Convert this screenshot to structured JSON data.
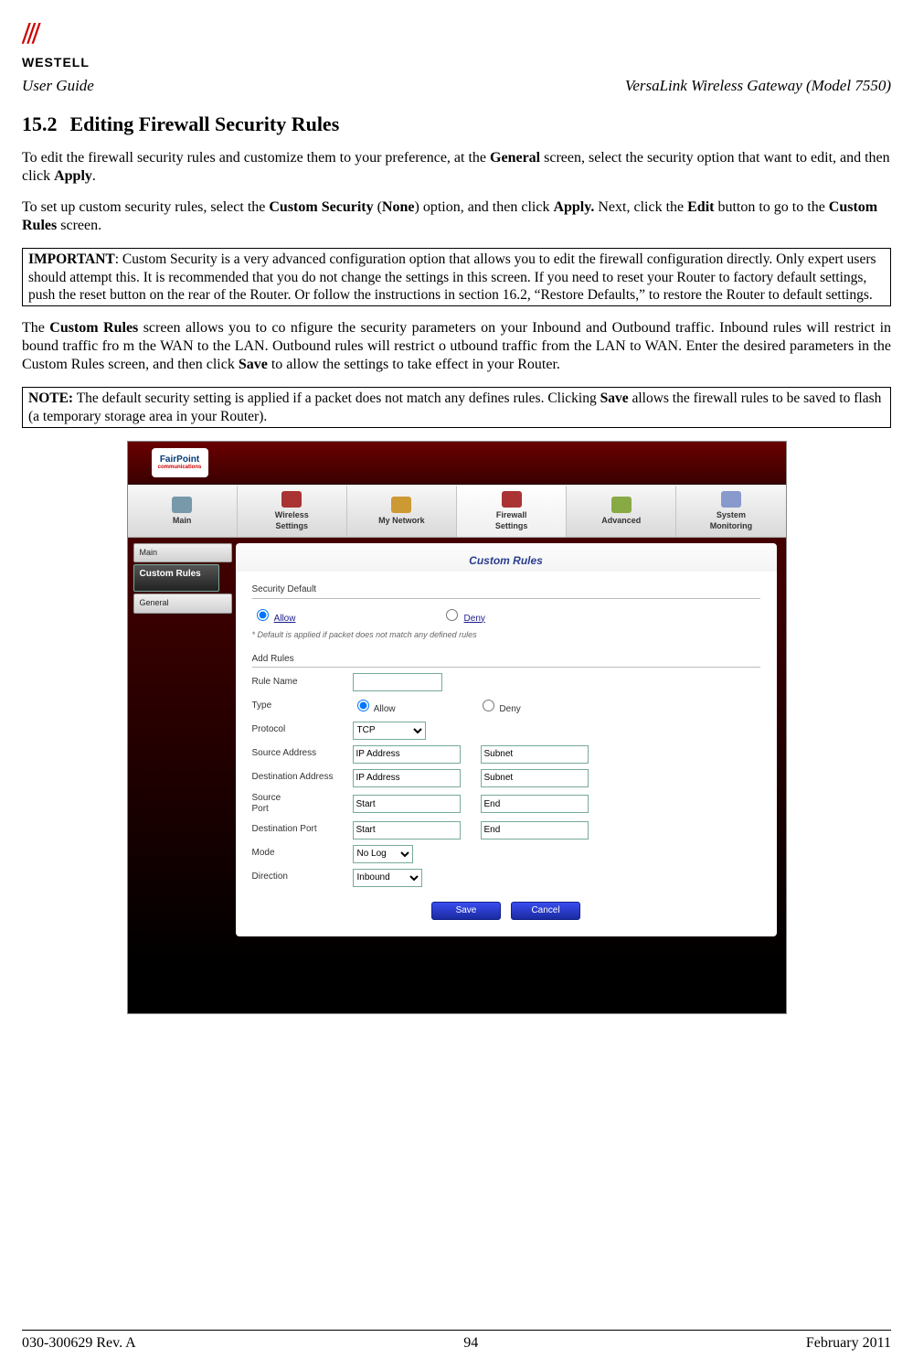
{
  "header": {
    "logo_text": "WESTELL",
    "left": "User Guide",
    "right": "VersaLink Wireless Gateway (Model 7550)"
  },
  "section": {
    "number": "15.2",
    "title": "Editing Firewall Security Rules"
  },
  "para1_a": "To edit the firewall security rules and customize them to your preference, at the ",
  "para1_b": "General",
  "para1_c": " screen, select the security option that want to edit, and then click ",
  "para1_d": "Apply",
  "para1_e": ".",
  "para2_a": "To set up custom security rules, select the ",
  "para2_b": "Custom Security",
  "para2_c": " (",
  "para2_d": "None",
  "para2_e": ") option, and then click ",
  "para2_f": "Apply.",
  "para2_g": " Next, click the ",
  "para2_h": "Edit",
  "para2_i": " button to go to the ",
  "para2_j": "Custom Rules",
  "para2_k": " screen.",
  "box1_a": "IMPORTANT",
  "box1_b": ": Custom Security is a very advanced configuration option that allows you to edit the firewall configuration directly. Only expert users should attempt this. It is recommended that you do not change the settings in this screen. If you need to reset your Router to factory default settings, push the reset button on the rear of the Router. Or follow the instructions in section 16.2, “Restore Defaults,” to restore the Router to default settings.",
  "para3_a": "The ",
  "para3_b": "Custom Rules",
  "para3_c": " screen allows you to co nfigure the security parameters on your Inbound and Outbound traffic. Inbound rules will restrict in bound traffic fro m the WAN to the LAN. Outbound rules will restrict o utbound traffic from the LAN to WAN. Enter the desired parameters in the Custom Rules screen, and then click ",
  "para3_d": "Save",
  "para3_e": " to allow the settings to take effect in your Router.",
  "box2_a": "NOTE:",
  "box2_b": " The default security setting is applied if a packet does not match any defines rules. Clicking ",
  "box2_c": "Save",
  "box2_d": " allows the firewall rules to be saved to flash (a temporary storage area in your Router).",
  "shot": {
    "brand1": "FairPoint",
    "brand2": "communications",
    "nav": {
      "main": "Main",
      "wireless1": "Wireless",
      "wireless2": "Settings",
      "mynet": "My Network",
      "fw1": "Firewall",
      "fw2": "Settings",
      "adv": "Advanced",
      "mon1": "System",
      "mon2": "Monitoring"
    },
    "side": {
      "main": "Main",
      "custom": "Custom Rules",
      "general": "General"
    },
    "panel_title": "Custom Rules",
    "security_default": "Security Default",
    "allow": "Allow",
    "deny": "Deny",
    "default_hint": "* Default is applied if packet does not match any defined rules",
    "add_rules": "Add Rules",
    "labels": {
      "rule_name": "Rule Name",
      "type": "Type",
      "protocol": "Protocol",
      "src_addr": "Source Address",
      "dst_addr": "Destination Address",
      "src_port1": "Source",
      "src_port2": "Port",
      "dst_port": "Destination Port",
      "mode": "Mode",
      "direction": "Direction"
    },
    "placeholders": {
      "ip": "IP Address",
      "subnet": "Subnet",
      "start": "Start",
      "end": "End"
    },
    "selects": {
      "protocol": "TCP",
      "mode": "No Log",
      "direction": "Inbound"
    },
    "buttons": {
      "save": "Save",
      "cancel": "Cancel"
    }
  },
  "footer": {
    "left": "030-300629 Rev. A",
    "center": "94",
    "right": "February 2011"
  }
}
